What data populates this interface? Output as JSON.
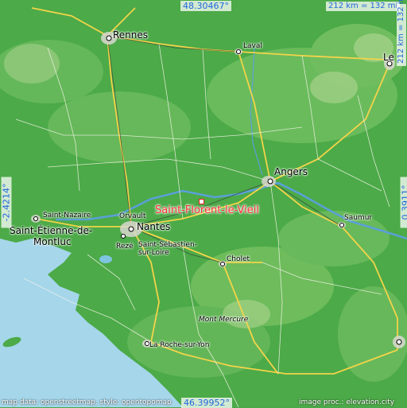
{
  "location": {
    "name": "Saint-Florent-le-Vieil",
    "color": "#ff2f2f"
  },
  "coordinates": {
    "top": "48.30467°",
    "bottom": "46.39952°",
    "left": "-2.4214°",
    "right": "0.3911°"
  },
  "scale": {
    "horizontal": "212 km = 132 mi",
    "vertical": "212 km = 132 mi"
  },
  "credits": {
    "left": "map data: openstreetmap, style: opentopomap",
    "right": "image proc.: elevation.city"
  },
  "cities": [
    {
      "name": "Rennes",
      "size": "lg"
    },
    {
      "name": "Laval",
      "size": "sm"
    },
    {
      "name": "Le",
      "size": "lg"
    },
    {
      "name": "Angers",
      "size": "lg"
    },
    {
      "name": "Saumur",
      "size": "sm"
    },
    {
      "name": "Saint-Nazaire",
      "size": "sm"
    },
    {
      "name": "Saint-Étienne-de-",
      "size": "lg"
    },
    {
      "name": "Montluc",
      "size": "lg"
    },
    {
      "name": "Orvault",
      "size": "sm"
    },
    {
      "name": "Nantes",
      "size": "lg"
    },
    {
      "name": "Rezé",
      "size": "sm"
    },
    {
      "name": "Saint-Sébastien-",
      "size": "sm"
    },
    {
      "name": "sur-Loire",
      "size": "sm"
    },
    {
      "name": "Cholet",
      "size": "sm"
    },
    {
      "name": "Mont Mercure",
      "size": "sm"
    },
    {
      "name": "La Roche-sur-Yon",
      "size": "sm"
    }
  ]
}
